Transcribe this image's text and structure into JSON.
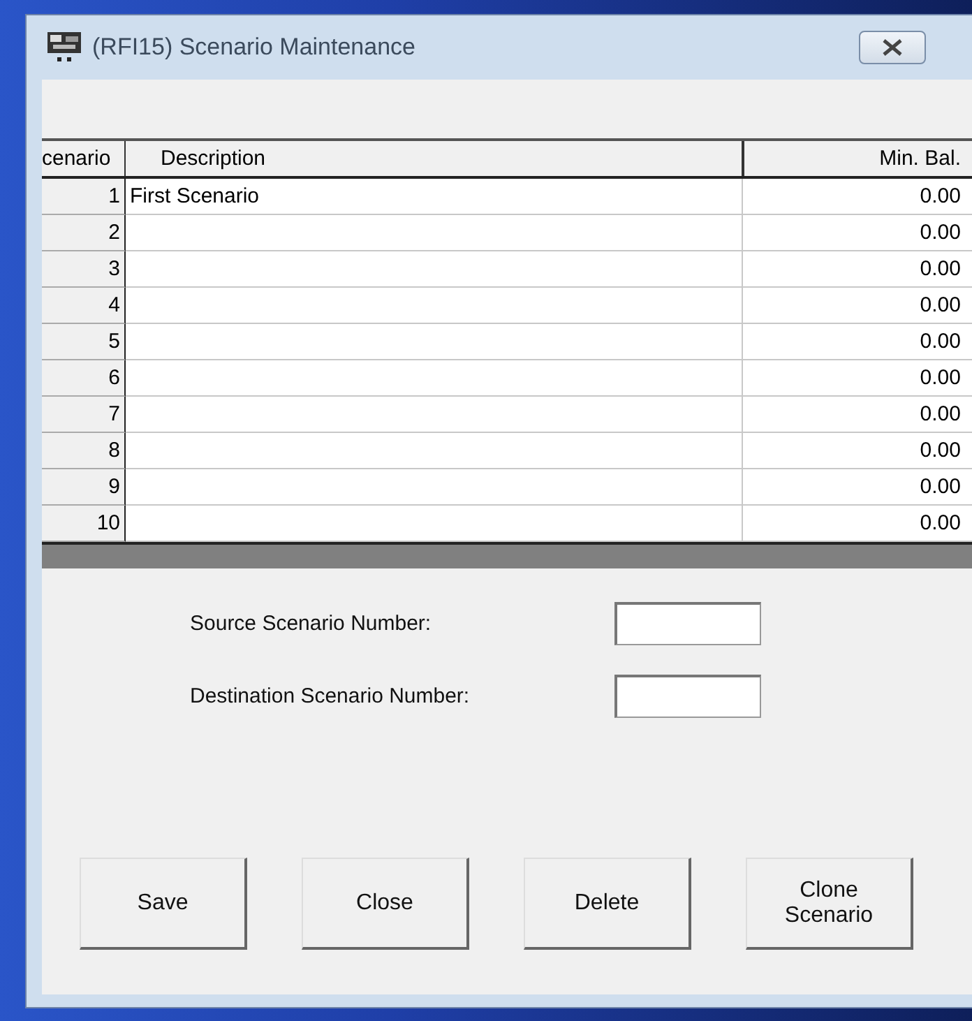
{
  "window": {
    "title": "(RFI15)  Scenario Maintenance"
  },
  "table": {
    "columns": [
      "cenario",
      "Description",
      "Min. Bal."
    ],
    "rows": [
      {
        "number": "1",
        "description": "First Scenario",
        "min_bal": "0.00"
      },
      {
        "number": "2",
        "description": "",
        "min_bal": "0.00"
      },
      {
        "number": "3",
        "description": "",
        "min_bal": "0.00"
      },
      {
        "number": "4",
        "description": "",
        "min_bal": "0.00"
      },
      {
        "number": "5",
        "description": "",
        "min_bal": "0.00"
      },
      {
        "number": "6",
        "description": "",
        "min_bal": "0.00"
      },
      {
        "number": "7",
        "description": "",
        "min_bal": "0.00"
      },
      {
        "number": "8",
        "description": "",
        "min_bal": "0.00"
      },
      {
        "number": "9",
        "description": "",
        "min_bal": "0.00"
      },
      {
        "number": "10",
        "description": "",
        "min_bal": "0.00"
      }
    ]
  },
  "fields": [
    {
      "label": "Source Scenario Number:"
    },
    {
      "label": "Destination Scenario Number:"
    }
  ],
  "buttons": [
    {
      "label": "Save"
    },
    {
      "label": "Close"
    },
    {
      "label": "Delete"
    },
    {
      "label": "Clone Scenario"
    }
  ]
}
